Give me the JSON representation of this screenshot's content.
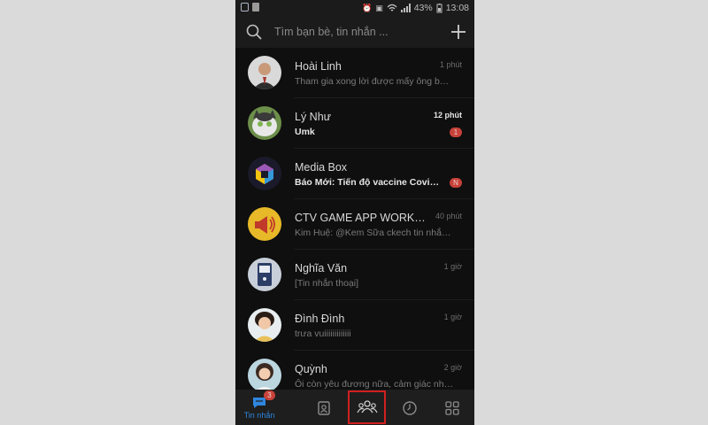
{
  "status_bar": {
    "battery": "43%",
    "time": "13:08"
  },
  "search": {
    "placeholder": "Tìm bạn bè, tin nhắn ..."
  },
  "conversations": [
    {
      "name": "Hoài Linh",
      "preview": "Tham gia xong lời được mấy ông bạn ...",
      "time": "1 phút",
      "unread": false,
      "badge": ""
    },
    {
      "name": "Lý Như",
      "preview": "Umk",
      "time": "12 phút",
      "unread": true,
      "badge": "1"
    },
    {
      "name": "Media Box",
      "preview": "Báo Mới: Tiến độ vaccine Covid-19...",
      "time": "",
      "unread": true,
      "badge": "N"
    },
    {
      "name": "CTV GAME APP WORK ON...",
      "preview": "Kim Huệ: @Kem Sữa ckech tin nhắn gi...",
      "time": "40 phút",
      "unread": false,
      "badge": ""
    },
    {
      "name": "Nghĩa Văn",
      "preview": "[Tin nhắn thoại]",
      "time": "1 giờ",
      "unread": false,
      "badge": ""
    },
    {
      "name": "Đình Đình",
      "preview": "trưa vuiiiiiiiiiiiii",
      "time": "1 giờ",
      "unread": false,
      "badge": ""
    },
    {
      "name": "Quỳnh",
      "preview": "Ôi còn yêu đương nữa, cảm giác như ...",
      "time": "2 giờ",
      "unread": false,
      "badge": ""
    }
  ],
  "tabs": [
    {
      "label": "Tin nhắn",
      "icon": "chat-bubble-icon",
      "badge": "3",
      "active": true
    },
    {
      "label": "",
      "icon": "contacts-icon",
      "badge": "",
      "active": false
    },
    {
      "label": "",
      "icon": "group-people-icon",
      "badge": "",
      "active": false,
      "highlighted": true
    },
    {
      "label": "",
      "icon": "clock-icon",
      "badge": "",
      "active": false
    },
    {
      "label": "",
      "icon": "grid-more-icon",
      "badge": "",
      "active": false
    }
  ],
  "colors": {
    "accent": "#2e86de",
    "badge": "#c7423a",
    "highlight_box": "#d11f1f",
    "background": "#0f0f0f"
  }
}
